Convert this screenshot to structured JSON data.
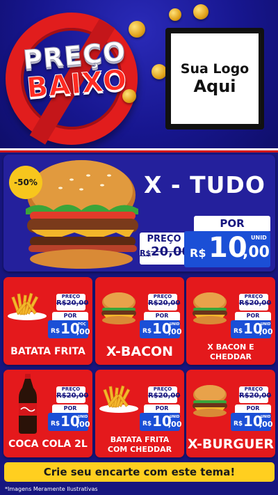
{
  "header": {
    "brand_line1": "PREÇO",
    "brand_line2": "BAIXO",
    "logo_line1": "Sua Logo",
    "logo_line2": "Aqui"
  },
  "featured": {
    "name": "X - TUDO",
    "discount": "-50%",
    "old_label": "PREÇO",
    "old_currency": "R$",
    "old_price": "20,00",
    "por_label": "POR",
    "currency": "R$",
    "price_int": "10",
    "price_dec": ",00",
    "unit": "UNID",
    "image_icon": "burger-icon"
  },
  "products": [
    {
      "name": "BATATA FRITA",
      "image_icon": "fries-icon",
      "old_label": "PREÇO",
      "old_price": "R$20,00",
      "por_label": "POR",
      "currency": "R$",
      "price_int": "10",
      "price_dec": ",00",
      "unit": "POÇ"
    },
    {
      "name": "X-BACON",
      "image_icon": "burger-icon",
      "old_label": "PREÇO",
      "old_price": "R$20,00",
      "por_label": "POR",
      "currency": "R$",
      "price_int": "10",
      "price_dec": ",00",
      "unit": "UNID"
    },
    {
      "name_line1": "X BACON E",
      "name_line2": "CHEDDAR",
      "image_icon": "burger-icon",
      "old_label": "PREÇO",
      "old_price": "R$20,00",
      "por_label": "POR",
      "currency": "R$",
      "price_int": "10",
      "price_dec": ",00",
      "unit": "UNID"
    },
    {
      "name": "COCA COLA 2L",
      "image_icon": "bottle-icon",
      "old_label": "PREÇO",
      "old_price": "R$20,00",
      "por_label": "POR",
      "currency": "R$",
      "price_int": "10",
      "price_dec": ",00",
      "unit": "UNID"
    },
    {
      "name_line1": "BATATA FRITA",
      "name_line2": "COM CHEDDAR",
      "image_icon": "fries-icon",
      "old_label": "PREÇO",
      "old_price": "R$20,00",
      "por_label": "POR",
      "currency": "R$",
      "price_int": "10",
      "price_dec": ",00",
      "unit": "UNID"
    },
    {
      "name": "X-BURGUER",
      "image_icon": "burger-icon",
      "old_label": "PREÇO",
      "old_price": "R$20,00",
      "por_label": "POR",
      "currency": "R$",
      "price_int": "10",
      "price_dec": ",00",
      "unit": "UNID"
    }
  ],
  "footer": {
    "cta": "Crie seu encarte com este tema!",
    "disclaimer": "*Imagens Meramente Ilustrativas"
  },
  "colors": {
    "background": "#17167f",
    "card_red": "#e4191c",
    "price_blue": "#1b4fd6",
    "badge_yellow": "#f7c61d",
    "cta_yellow": "#ffcf1f"
  }
}
